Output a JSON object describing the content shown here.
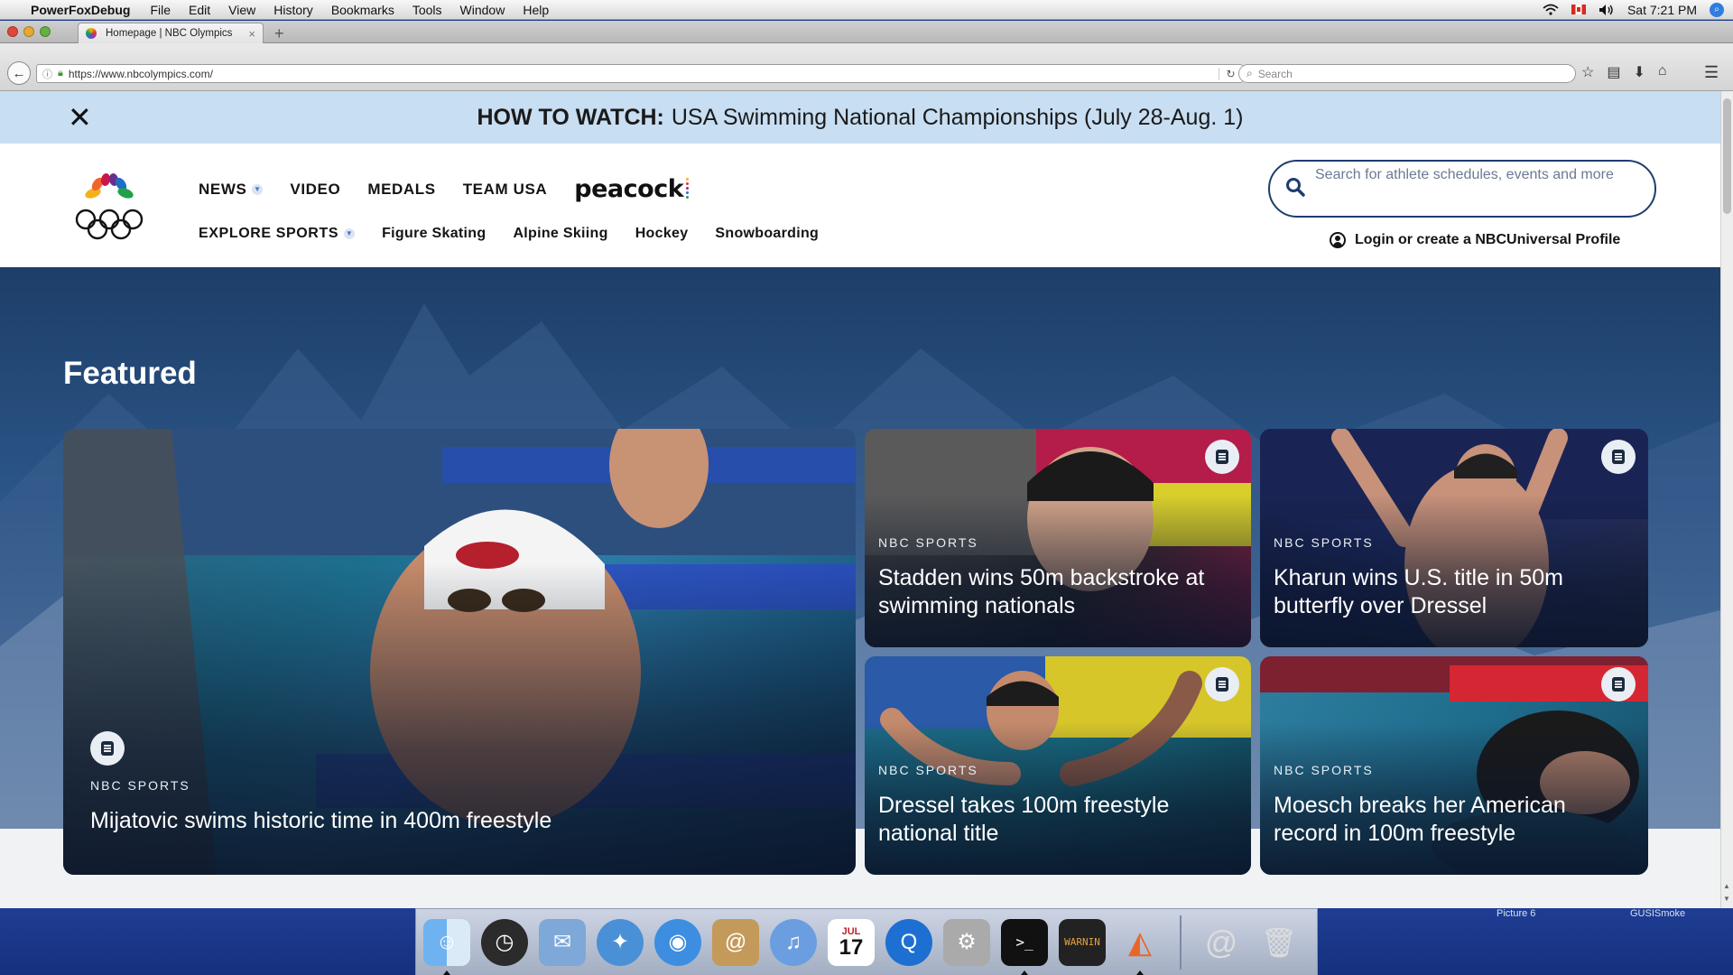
{
  "menubar": {
    "app_name": "PowerFoxDebug",
    "menus": [
      "File",
      "Edit",
      "View",
      "History",
      "Bookmarks",
      "Tools",
      "Window",
      "Help"
    ],
    "clock": "Sat 7:21 PM"
  },
  "browser": {
    "tab_title": "Homepage | NBC Olympics",
    "tab_close": "×",
    "new_tab": "+",
    "url": "https://www.nbcolympics.com/",
    "search_placeholder": "Search"
  },
  "banner": {
    "bold": "HOW TO WATCH:",
    "text": "USA Swimming National Championships (July 28-Aug. 1)",
    "close": "✕"
  },
  "nav": {
    "primary": [
      "NEWS",
      "VIDEO",
      "MEDALS",
      "TEAM USA"
    ],
    "peacock": "peacock",
    "explore": "EXPLORE SPORTS",
    "sports": [
      "Figure Skating",
      "Alpine Skiing",
      "Hockey",
      "Snowboarding"
    ],
    "search_placeholder": "Search for athlete schedules, events and more",
    "login": "Login or create a NBCUniversal Profile"
  },
  "featured": {
    "heading": "Featured",
    "cards": [
      {
        "source": "NBC SPORTS",
        "title": "Mijatovic swims historic time in 400m freestyle"
      },
      {
        "source": "NBC SPORTS",
        "title": "Stadden wins 50m backstroke at swimming nationals"
      },
      {
        "source": "NBC SPORTS",
        "title": "Kharun wins U.S. title in 50m butterfly over Dressel"
      },
      {
        "source": "NBC SPORTS",
        "title": "Dressel takes 100m freestyle national title"
      },
      {
        "source": "NBC SPORTS",
        "title": "Moesch breaks her American record in 100m freestyle"
      }
    ]
  },
  "desktop": {
    "label_left": "Picture 6",
    "label_right": "GUSISmoke"
  },
  "dock": {
    "calendar_month": "JUL",
    "calendar_day": "17",
    "console_text": "WARNIN"
  },
  "colors": {
    "banner_bg": "#c8def2",
    "featured_bg": "#2b5587",
    "nav_accent": "#1d3d6e"
  }
}
